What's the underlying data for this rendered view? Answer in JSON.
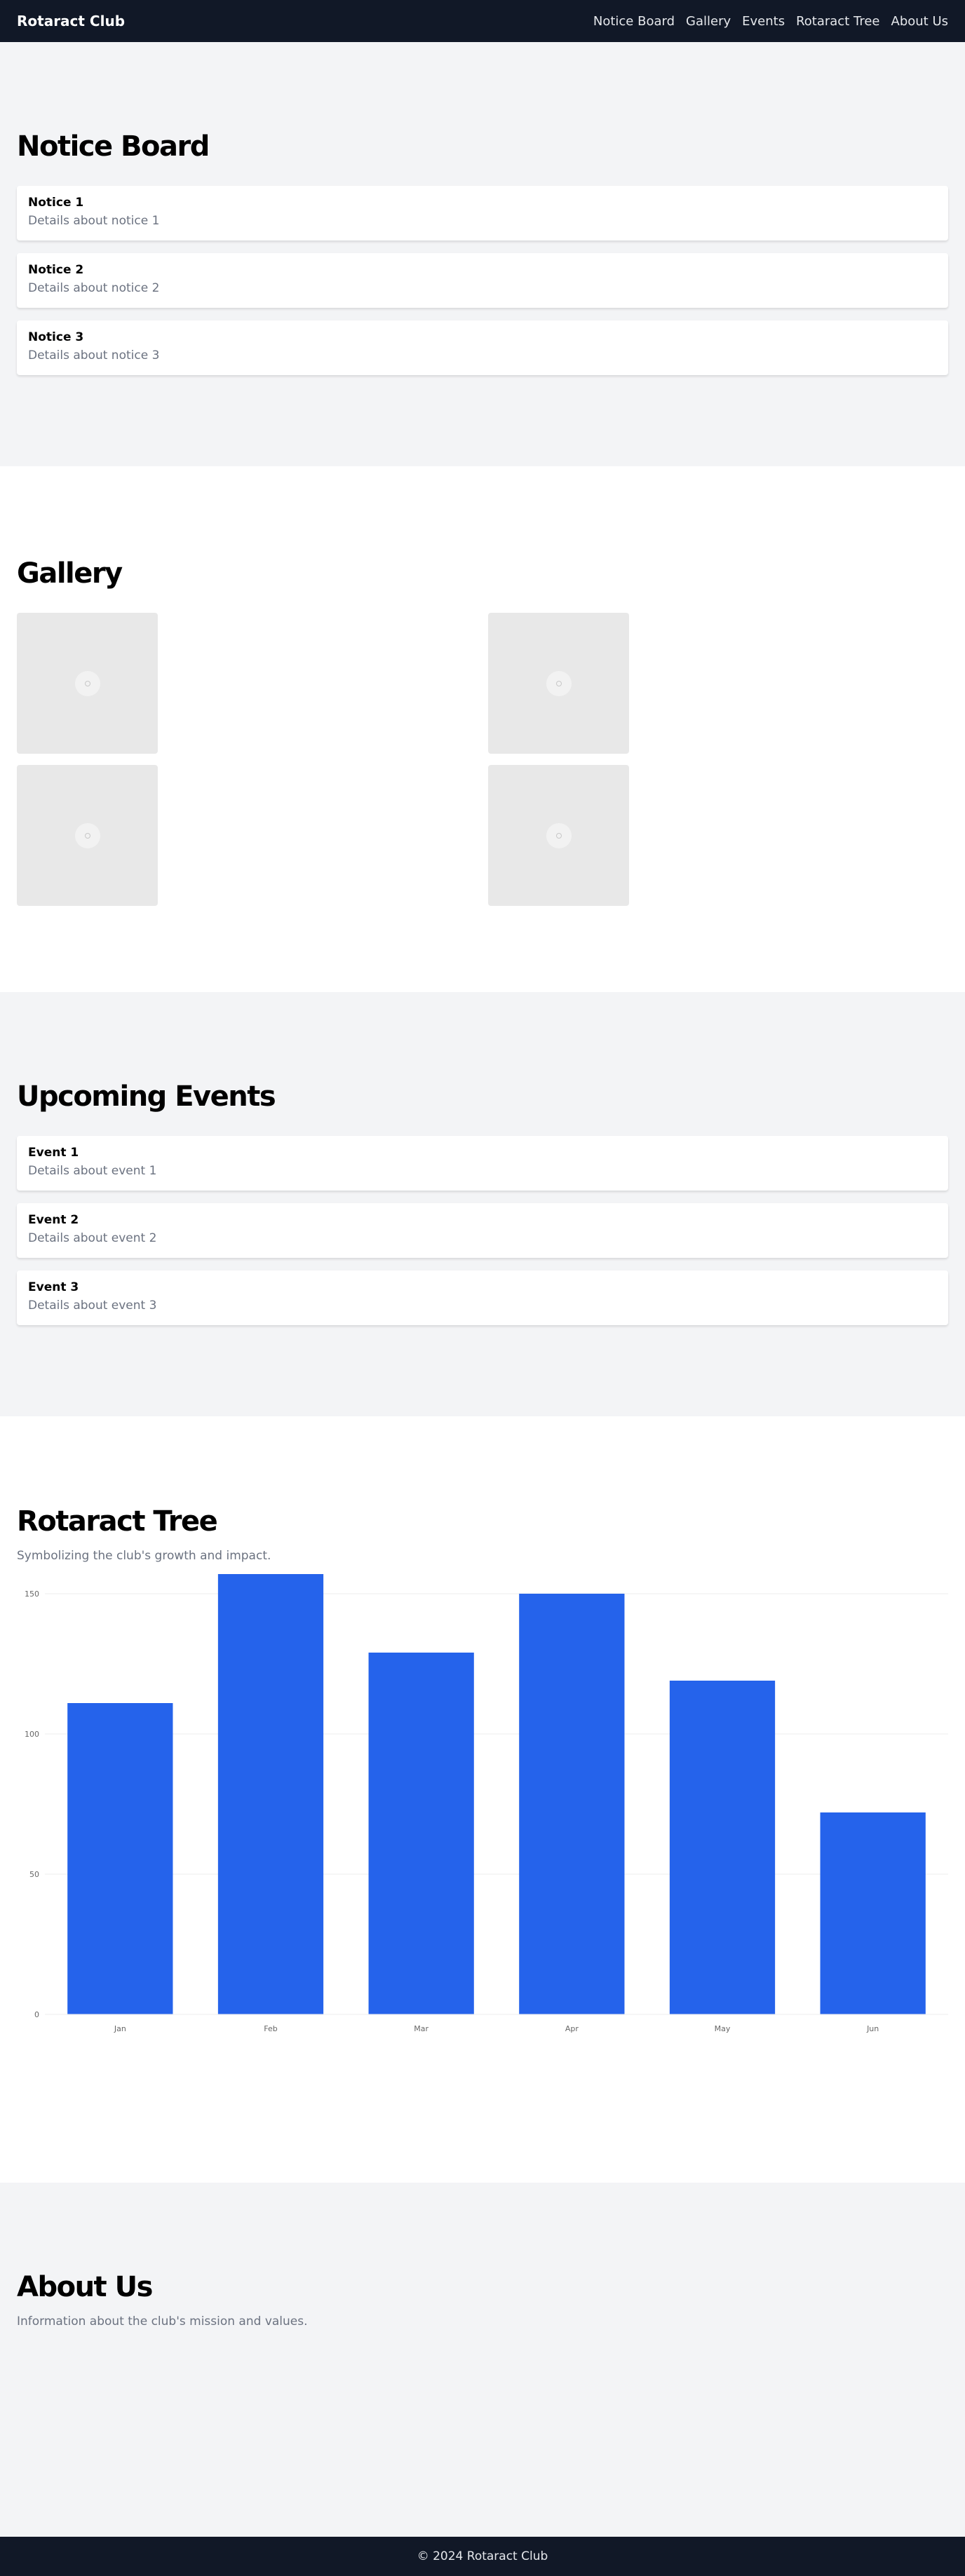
{
  "nav": {
    "brand": "Rotaract Club",
    "links": [
      "Notice Board",
      "Gallery",
      "Events",
      "Rotaract Tree",
      "About Us"
    ]
  },
  "notice_board": {
    "title": "Notice Board",
    "items": [
      {
        "title": "Notice 1",
        "text": "Details about notice 1"
      },
      {
        "title": "Notice 2",
        "text": "Details about notice 2"
      },
      {
        "title": "Notice 3",
        "text": "Details about notice 3"
      }
    ]
  },
  "gallery": {
    "title": "Gallery",
    "image_count": 4
  },
  "events": {
    "title": "Upcoming Events",
    "items": [
      {
        "title": "Event 1",
        "text": "Details about event 1"
      },
      {
        "title": "Event 2",
        "text": "Details about event 2"
      },
      {
        "title": "Event 3",
        "text": "Details about event 3"
      }
    ]
  },
  "tree": {
    "title": "Rotaract Tree",
    "subtitle": "Symbolizing the club's growth and impact."
  },
  "chart_data": {
    "type": "bar",
    "categories": [
      "Jan",
      "Feb",
      "Mar",
      "Apr",
      "May",
      "Jun"
    ],
    "values": [
      111,
      157,
      129,
      150,
      119,
      72
    ],
    "ylim": [
      0,
      157
    ],
    "yticks": [
      0,
      50,
      100,
      150
    ],
    "grid": true,
    "bar_color": "#2563eb"
  },
  "about": {
    "title": "About Us",
    "text": "Information about the club's mission and values."
  },
  "footer": {
    "text": "© 2024 Rotaract Club"
  },
  "colors": {
    "nav_bg": "#111827",
    "section_alt_bg": "#f3f4f6",
    "muted_text": "#6b7280",
    "accent": "#2563eb"
  }
}
